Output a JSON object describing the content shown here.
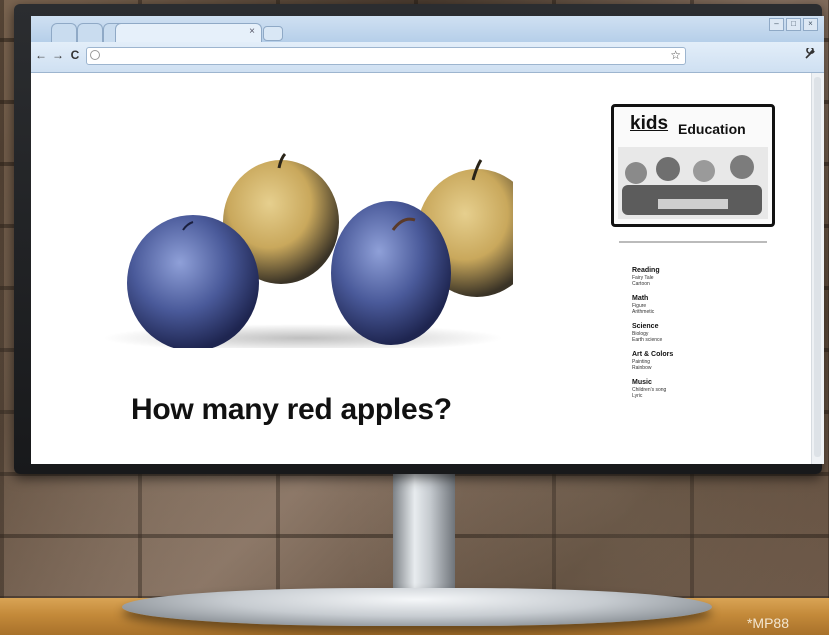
{
  "browser": {
    "nav": {
      "back": "←",
      "forward": "→",
      "reload": "C"
    },
    "tab_close": "×",
    "star": "☆",
    "wrench": "🔧",
    "window_controls": [
      "–",
      "□",
      "×"
    ]
  },
  "page": {
    "question": "How many red apples?",
    "logo": {
      "kids": "kids",
      "education": "Education"
    },
    "menu": [
      {
        "title": "Reading",
        "items": [
          "Fairy Tale",
          "Cartoon"
        ]
      },
      {
        "title": "Math",
        "items": [
          "Figure",
          "Arithmetic"
        ]
      },
      {
        "title": "Science",
        "items": [
          "Biology",
          "Earth science"
        ]
      },
      {
        "title": "Art & Colors",
        "items": [
          "Painting",
          "Rainbow"
        ]
      },
      {
        "title": "Music",
        "items": [
          "Children's song",
          "Lyric"
        ]
      }
    ]
  },
  "watermark": "*MP88",
  "colors": {
    "apple_blue": "#4a5a9a",
    "apple_gold": "#c9a85c",
    "chrome_blue": "#b6cfe9"
  }
}
